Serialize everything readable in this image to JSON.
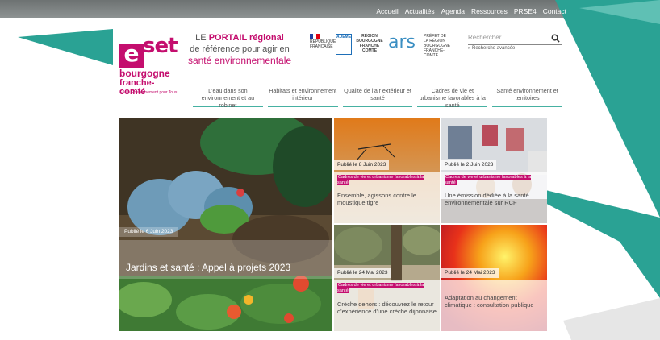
{
  "top_nav": [
    "Accueil",
    "Actualités",
    "Agenda",
    "Ressources",
    "PRSE4",
    "Contact"
  ],
  "logo": {
    "letter_e": "e",
    "set": "set",
    "line1": "bourgogne",
    "line2": "franche-comté",
    "tagline": "Santé Environnement pour Tous"
  },
  "tagline": {
    "prefix": "LE",
    "highlight": "PORTAIL régional",
    "line2": "de référence pour agir en",
    "line3": "santé environnementale"
  },
  "partners": {
    "rf": "RÉPUBLIQUE FRANÇAISE",
    "ademe": "ADEME",
    "region": "RÉGION BOURGOGNE FRANCHE COMTE",
    "ars": "ars",
    "dreal": "PRÉFET DE LA RÉGION BOURGOGNE FRANCHE-COMTÉ"
  },
  "search": {
    "placeholder": "Rechercher",
    "advanced": "» Recherche avancée"
  },
  "main_nav": [
    "L'eau dans son environnement et au robinet",
    "Habitats et environnement intérieur",
    "Qualité de l'air extérieur et santé",
    "Cadres de vie et urbanisme favorables à la santé",
    "Santé environnement et territoires"
  ],
  "hero": {
    "date": "Publié le 6 Juin 2023",
    "title": "Jardins et santé : Appel à projets 2023"
  },
  "cards": [
    {
      "date": "Publié le 8 Juin 2023",
      "category": "Cadres de vie et urbanisme favorables à la santé",
      "title": "Ensemble, agissons contre le moustique tigre"
    },
    {
      "date": "Publié le 2 Juin 2023",
      "category": "Cadres de vie et urbanisme favorables à la santé",
      "title": "Une émission dédiée à la santé environnementale sur RCF"
    },
    {
      "date": "Publié le 24 Mai 2023",
      "category": "Cadres de vie et urbanisme favorables à la santé",
      "title": "Crèche dehors : découvrez le retour d'expérience d'une crèche dijonnaise"
    },
    {
      "date": "Publié le 24 Mai 2023",
      "category": "",
      "title": "Adaptation au changement climatique : consultation publique"
    }
  ],
  "colors": {
    "brand": "#c40e6e",
    "teal": "#2aa294",
    "nav_underline": "#46b1a2"
  }
}
